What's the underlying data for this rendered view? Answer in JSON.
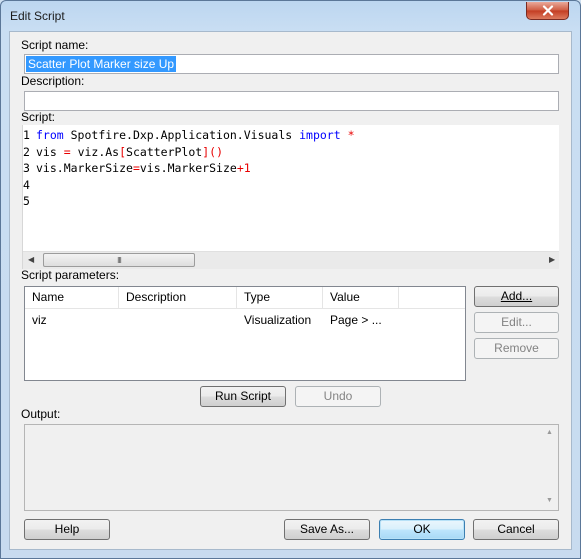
{
  "window": {
    "title": "Edit Script"
  },
  "fields": {
    "script_name_label": "Script name:",
    "script_name_value": "Scatter Plot Marker size Up",
    "description_label": "Description:",
    "description_value": "",
    "script_label": "Script:"
  },
  "editor": {
    "line_numbers": [
      "1",
      "2",
      "3",
      "4",
      "5"
    ],
    "lines": [
      [
        {
          "t": "from",
          "c": "kw"
        },
        {
          "t": " Spotfire.Dxp.Application.Visuals ",
          "c": ""
        },
        {
          "t": "import",
          "c": "kw"
        },
        {
          "t": " ",
          "c": ""
        },
        {
          "t": "*",
          "c": "op"
        }
      ],
      [
        {
          "t": "vis ",
          "c": ""
        },
        {
          "t": "=",
          "c": "op"
        },
        {
          "t": " viz.As",
          "c": ""
        },
        {
          "t": "[",
          "c": "op"
        },
        {
          "t": "ScatterPlot",
          "c": ""
        },
        {
          "t": "]()",
          "c": "op"
        }
      ],
      [
        {
          "t": "vis.MarkerSize",
          "c": ""
        },
        {
          "t": "=",
          "c": "op"
        },
        {
          "t": "vis.MarkerSize",
          "c": ""
        },
        {
          "t": "+1",
          "c": "op"
        }
      ],
      [],
      []
    ],
    "hscroll": {
      "left_arrow": "◀",
      "right_arrow": "▶",
      "grip": "III"
    }
  },
  "parameters": {
    "label": "Script parameters:",
    "columns": [
      "Name",
      "Description",
      "Type",
      "Value"
    ],
    "rows": [
      {
        "name": "viz",
        "description": "",
        "type": "Visualization",
        "value": "Page > ..."
      }
    ],
    "add_label": "Add...",
    "edit_label": "Edit...",
    "remove_label": "Remove"
  },
  "actions": {
    "run_label": "Run Script",
    "undo_label": "Undo"
  },
  "output": {
    "label": "Output:",
    "up_arrow": "▲",
    "down_arrow": "▼"
  },
  "footer": {
    "help_label": "Help",
    "save_as_label": "Save As...",
    "ok_label": "OK",
    "cancel_label": "Cancel"
  },
  "colors": {
    "keyword": "#0000ff",
    "operator": "#e80000",
    "selection": "#3399ff"
  },
  "icons": {
    "close": "close-icon"
  }
}
